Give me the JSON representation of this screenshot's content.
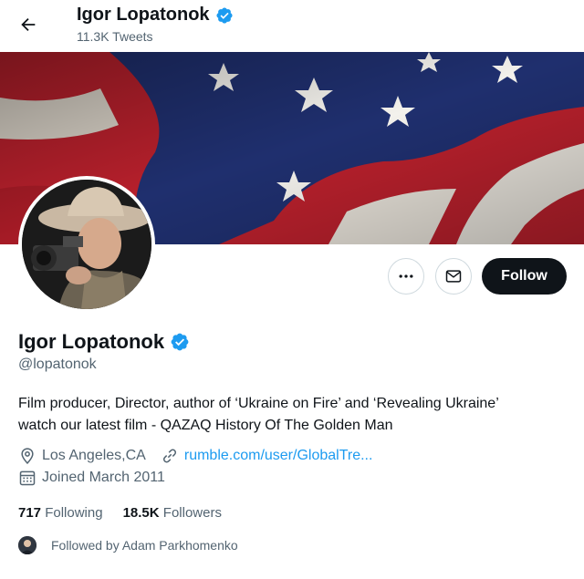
{
  "header": {
    "name": "Igor Lopatonok",
    "tweet_count": "11.3K Tweets"
  },
  "profile": {
    "name": "Igor Lopatonok",
    "handle": "@lopatonok",
    "bio_line1": "Film producer, Director, author of ‘Ukraine on Fire’ and ‘Revealing Ukraine’",
    "bio_line2": "watch our latest film - QAZAQ History Of The Golden Man",
    "location": "Los Angeles,CA",
    "website": "rumble.com/user/GlobalTre...",
    "joined": "Joined March 2011",
    "following_count": "717",
    "following_label": "Following",
    "followers_count": "18.5K",
    "followers_label": "Followers",
    "followed_by": "Followed by Adam Parkhomenko"
  },
  "actions": {
    "follow_label": "Follow"
  },
  "icons": {
    "back": "arrow-left-icon",
    "verified": "verified-badge-icon",
    "more": "ellipsis-icon",
    "message": "envelope-icon",
    "location": "location-pin-icon",
    "link": "link-icon",
    "calendar": "calendar-icon"
  },
  "colors": {
    "accent": "#1d9bf0",
    "text": "#0f1419",
    "muted": "#536471",
    "follow_button": "#0f1419"
  }
}
